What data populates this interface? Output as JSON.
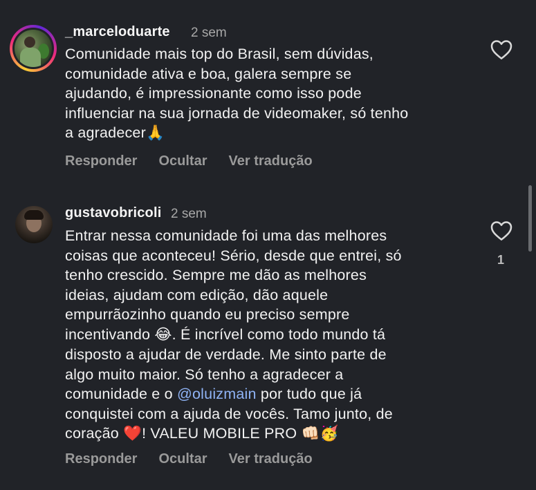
{
  "comments": [
    {
      "username": "_marceloduarte",
      "time": "2 sem",
      "lines": [
        "Comunidade mais top do Brasil, sem dúvidas,",
        "comunidade ativa e boa, galera sempre se",
        "ajudando, é impressionante como isso pode",
        "influenciar na sua jornada de videomaker, só tenho",
        "a agradecer"
      ],
      "emoji_end": "🙏",
      "actions": {
        "reply": "Responder",
        "hide": "Ocultar",
        "translate": "Ver tradução"
      }
    },
    {
      "username": "gustavobricoli",
      "time": "2 sem",
      "lines": [
        "Entrar nessa comunidade foi uma das melhores",
        "coisas que aconteceu! Sério, desde que entrei, só",
        "tenho crescido. Sempre me dão as melhores",
        "ideias, ajudam com edição, dão aquele",
        "empurrãozinho quando eu preciso sempre",
        "incentivando",
        ". É incrível como todo mundo tá",
        "disposto a ajudar de verdade. Me sinto parte de",
        "algo muito maior. Só tenho a agradecer a",
        "comunidade e o",
        "@oluizmain",
        "por tudo que já",
        "conquistei com a ajuda de vocês. Tamo junto, de",
        "coração",
        "! VALEU MOBILE PRO"
      ],
      "emojis": {
        "laugh": "😂",
        "heart": "❤️",
        "fist": "👊🏻",
        "party": "🥳"
      },
      "likes": "1",
      "actions": {
        "reply": "Responder",
        "hide": "Ocultar",
        "translate": "Ver tradução"
      }
    }
  ],
  "colors": {
    "background": "#212328",
    "text": "#f2f2f2",
    "muted": "#9a9a9a",
    "mention": "#8fb3f5"
  },
  "icons": [
    "heart-outline-icon"
  ]
}
